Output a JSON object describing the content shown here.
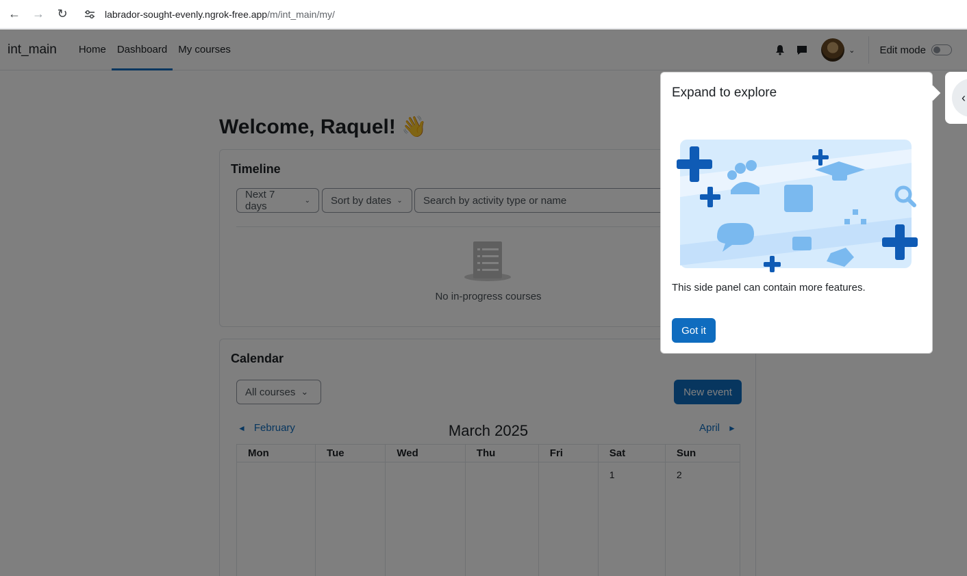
{
  "browser": {
    "url_host": "labrador-sought-evenly.ngrok-free.app",
    "url_path": "/m/int_main/my/"
  },
  "navbar": {
    "brand": "int_main",
    "items": [
      {
        "label": "Home",
        "active": false
      },
      {
        "label": "Dashboard",
        "active": true
      },
      {
        "label": "My courses",
        "active": false
      }
    ],
    "edit_mode_label": "Edit mode"
  },
  "main": {
    "welcome": "Welcome, Raquel! 👋",
    "timeline": {
      "title": "Timeline",
      "filter_days": "Next 7 days",
      "sort": "Sort by dates",
      "search_placeholder": "Search by activity type or name",
      "empty_text": "No in-progress courses"
    },
    "calendar": {
      "title": "Calendar",
      "course_filter": "All courses",
      "new_event": "New event",
      "prev_month": "February",
      "month_title": "March 2025",
      "next_month": "April",
      "weekdays": [
        "Mon",
        "Tue",
        "Wed",
        "Thu",
        "Fri",
        "Sat",
        "Sun"
      ],
      "first_row": [
        "",
        "",
        "",
        "",
        "",
        "1",
        "2"
      ]
    }
  },
  "tour": {
    "title": "Expand to explore",
    "text": "This side panel can contain more features.",
    "button": "Got it"
  },
  "colors": {
    "accent": "#0f6cbf",
    "illustration_light": "#d6ebfd",
    "illustration_mid": "#7ab9ef",
    "illustration_dark": "#0f5bb5"
  }
}
